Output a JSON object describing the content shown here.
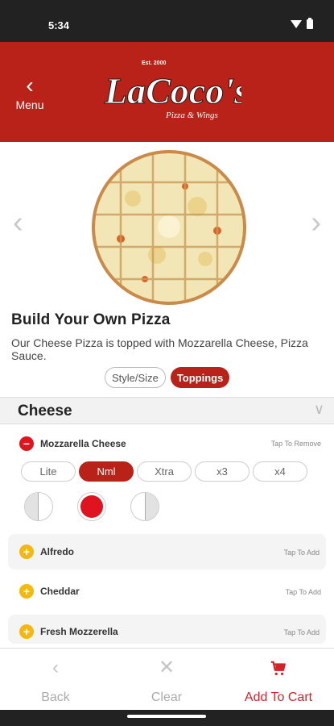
{
  "status_bar": {
    "time": "5:34"
  },
  "header": {
    "menu_label": "Menu",
    "logo": {
      "brand": "LaCoco's",
      "tagline": "Pizza & Wings",
      "est": "Est. 2000"
    }
  },
  "product": {
    "name": "Build Your Own Pizza",
    "description": "Our Cheese Pizza is topped with Mozzarella Cheese, Pizza Sauce."
  },
  "tabs": [
    {
      "label": "Style/Size",
      "active": false
    },
    {
      "label": "Toppings",
      "active": true
    }
  ],
  "section": {
    "title": "Cheese"
  },
  "selected_topping": {
    "name": "Mozzarella Cheese",
    "action_label": "Tap To Remove",
    "amounts": [
      "Lite",
      "Nml",
      "Xtra",
      "x3",
      "x4"
    ],
    "selected_amount": "Nml",
    "placement": "whole"
  },
  "toppings": [
    {
      "name": "Alfredo",
      "action_label": "Tap To Add"
    },
    {
      "name": "Cheddar",
      "action_label": "Tap To Add"
    },
    {
      "name": "Fresh Mozzerella",
      "action_label": "Tap To Add"
    }
  ],
  "bottom_bar": {
    "back_label": "Back",
    "clear_label": "Clear",
    "cart_label": "Add To Cart"
  },
  "colors": {
    "brand_red": "#b82218",
    "accent_red": "#e0141e",
    "add_yellow": "#f3b814"
  }
}
